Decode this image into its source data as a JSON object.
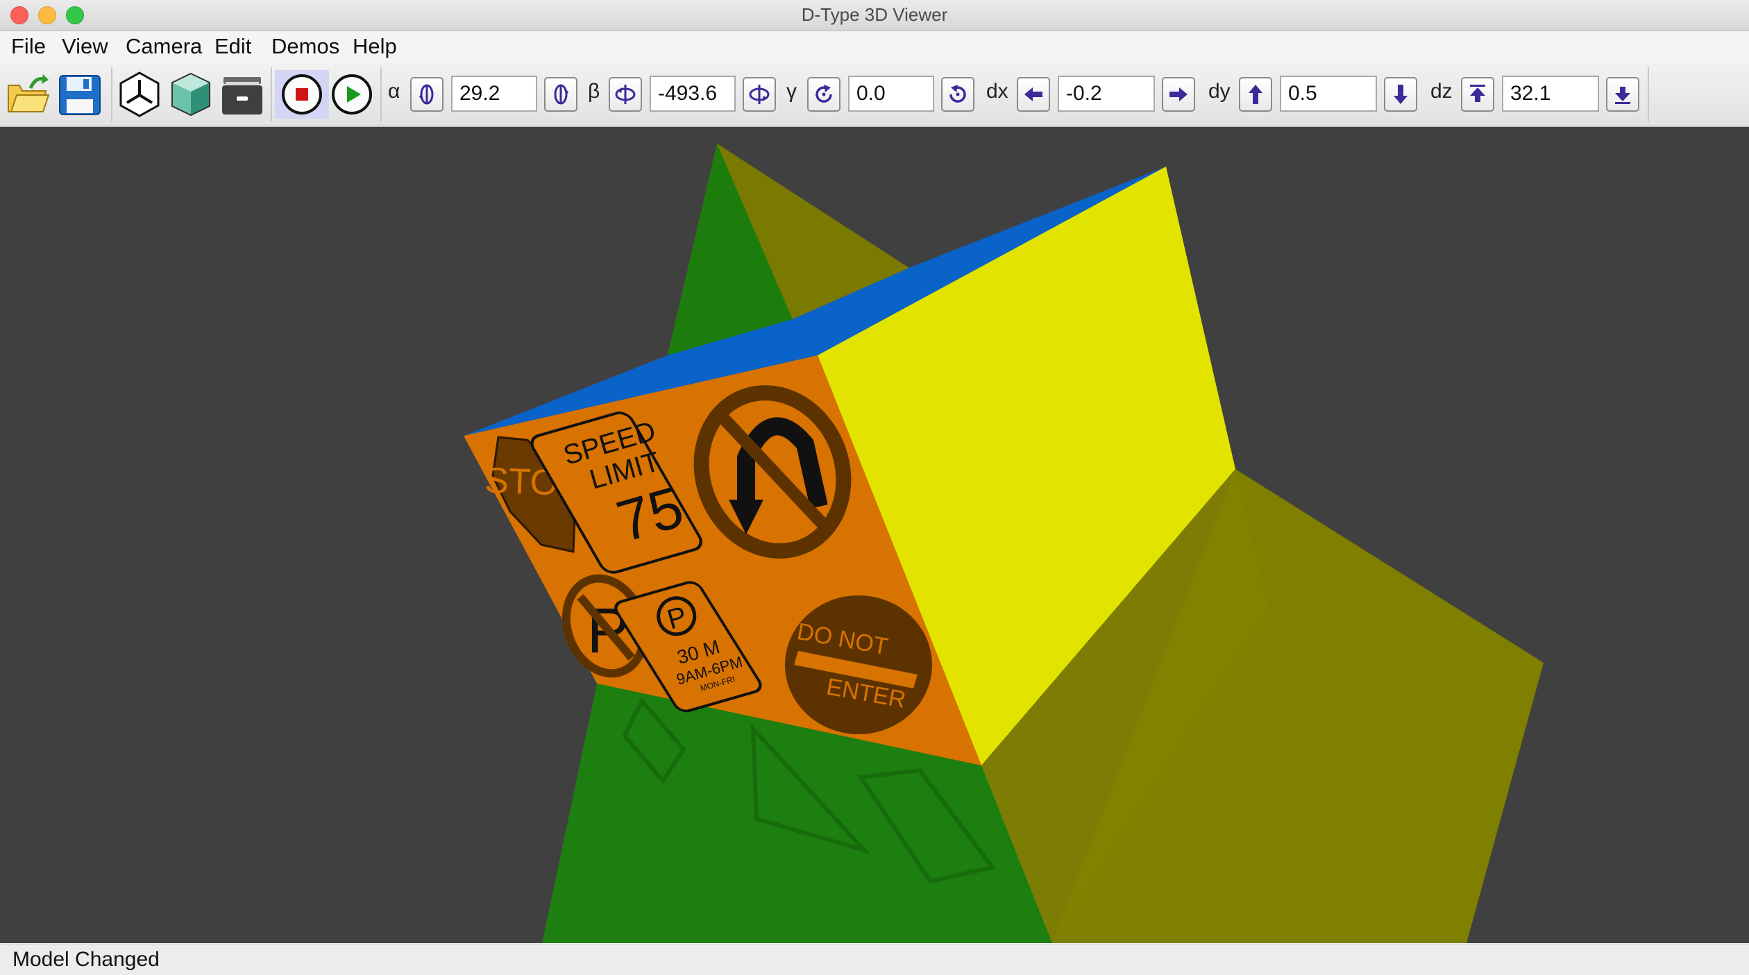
{
  "window": {
    "title": "D-Type 3D Viewer"
  },
  "menu": [
    "File",
    "View",
    "Camera",
    "Edit",
    "Demos",
    "Help"
  ],
  "toolbar": {
    "alpha": {
      "label": "α",
      "value": "29.2"
    },
    "beta": {
      "label": "β",
      "value": "-493.6"
    },
    "gamma": {
      "label": "γ",
      "value": "0.0"
    },
    "dx": {
      "label": "dx",
      "value": "-0.2"
    },
    "dy": {
      "label": "dy",
      "value": "0.5"
    },
    "dz": {
      "label": "dz",
      "value": "32.1"
    }
  },
  "scene": {
    "signs": {
      "stop": "STOP",
      "speed_line1": "SPEED",
      "speed_line2": "LIMIT",
      "speed_value": "75",
      "parking_letter": "P",
      "parking_time": "30 M",
      "parking_hours": "9AM-6PM",
      "parking_days": "MON-FRI",
      "do_not": "DO NOT",
      "enter": "ENTER"
    },
    "colors": {
      "background": "#404040",
      "orange_face": "#d87200",
      "yellow_face": "#e3e300",
      "blue_face": "#0a63c9",
      "green_face": "#1c7f0f",
      "olive_face": "#7f7f00",
      "sign_ink": "#5c3300"
    }
  },
  "status": "Model Changed"
}
